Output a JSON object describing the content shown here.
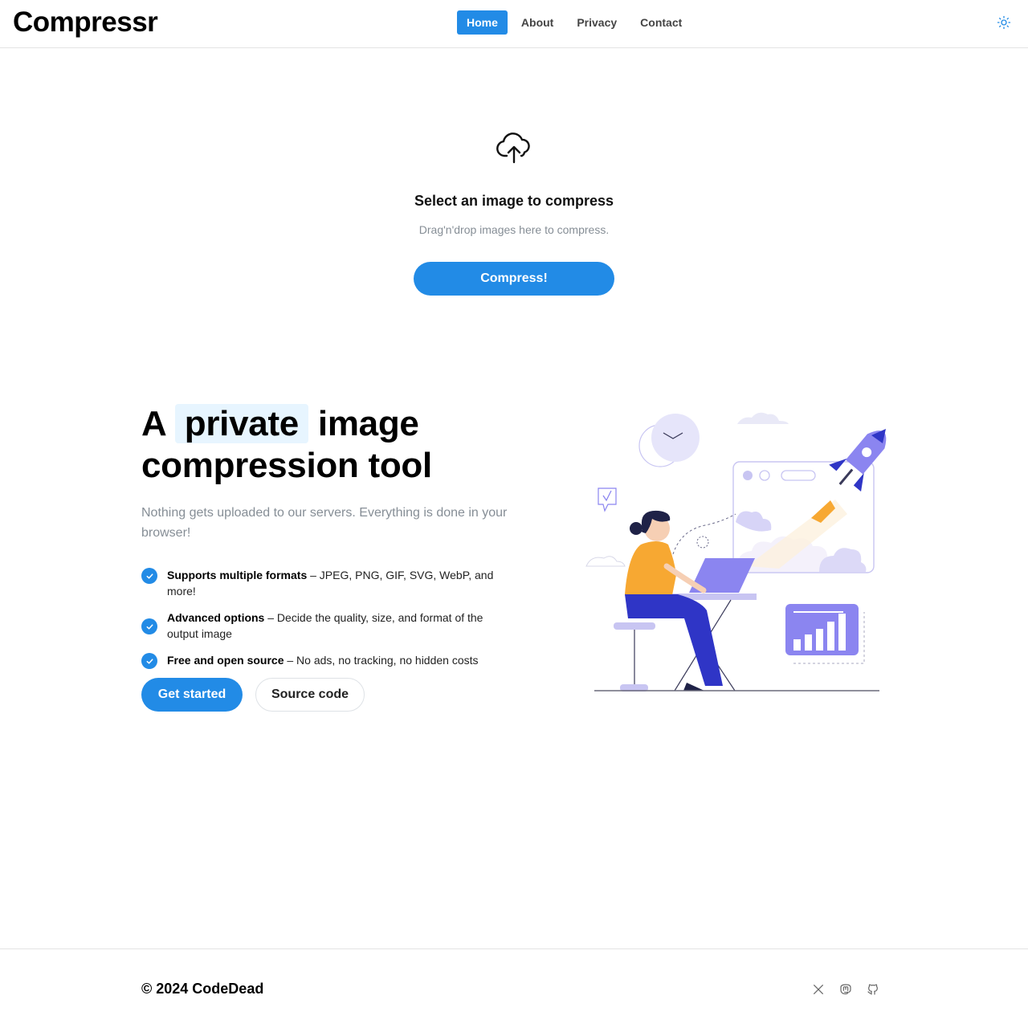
{
  "header": {
    "brand": "Compressr",
    "nav": [
      {
        "label": "Home",
        "active": true
      },
      {
        "label": "About",
        "active": false
      },
      {
        "label": "Privacy",
        "active": false
      },
      {
        "label": "Contact",
        "active": false
      }
    ],
    "theme_icon": "sun-icon"
  },
  "dropzone": {
    "icon": "cloud-upload-icon",
    "title": "Select an image to compress",
    "subtitle": "Drag'n'drop images here to compress.",
    "button": "Compress!"
  },
  "hero": {
    "title_prefix": "A",
    "title_highlight": "private",
    "title_suffix": "image compression tool",
    "subtitle": "Nothing gets uploaded to our servers. Everything is done in your browser!",
    "features": [
      {
        "bold": "Supports multiple formats",
        "text": " – JPEG, PNG, GIF, SVG, WebP, and more!"
      },
      {
        "bold": "Advanced options",
        "text": " – Decide the quality, size, and format of the output image"
      },
      {
        "bold": "Free and open source",
        "text": " – No ads, no tracking, no hidden costs"
      }
    ],
    "primary_button": "Get started",
    "secondary_button": "Source code"
  },
  "footer": {
    "copyright": "© 2024 CodeDead",
    "social": [
      "x-icon",
      "mastodon-icon",
      "github-icon"
    ]
  },
  "colors": {
    "accent": "#228be6",
    "highlight_bg": "#e7f5ff",
    "muted": "#868e96",
    "illustration_purple": "#8b85f0",
    "illustration_blue": "#2f35c6",
    "illustration_orange": "#f7a832"
  }
}
